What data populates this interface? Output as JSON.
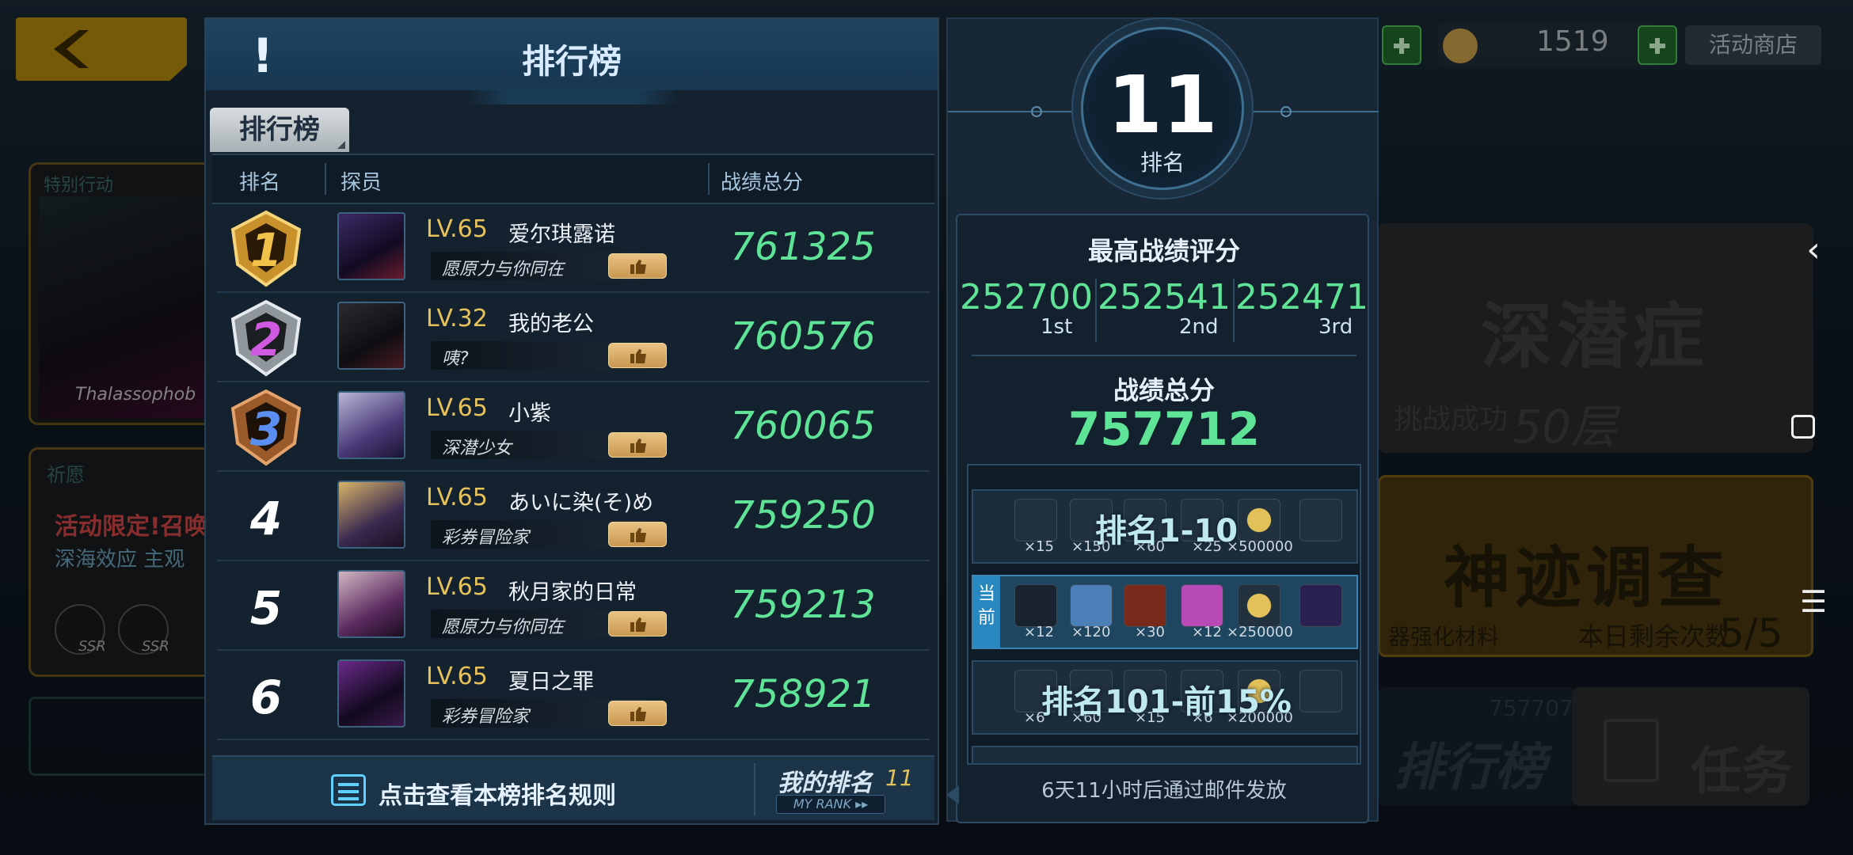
{
  "background": {
    "card1": {
      "tag": "特别行动",
      "name": "Thalassophob"
    },
    "card2": {
      "tag": "祈愿",
      "line1": "活动限定!召唤",
      "line2": "深海效应  主观",
      "ssr_label": "SSR"
    },
    "resource": {
      "value": "1519",
      "shop_label": "活动商店"
    },
    "event1": {
      "title": "深潜症",
      "status": "挑战成功",
      "floor": "50层"
    },
    "event2": {
      "title": "神迹调查",
      "sub": "器强化材料",
      "remain_label": "本日剩余次数",
      "remain": "5/5"
    },
    "btn_rank": {
      "label": "排行榜",
      "score": "757707"
    },
    "btn_task": {
      "label": "任务"
    }
  },
  "leaderboard": {
    "title": "排行榜",
    "tab": "排行榜",
    "columns": {
      "rank": "排名",
      "agent": "探员",
      "score": "战绩总分"
    },
    "rows": [
      {
        "rank": "1",
        "level": "LV.65",
        "name": "爱尔琪露诺",
        "title": "愿原力与你同在",
        "score": "761325"
      },
      {
        "rank": "2",
        "level": "LV.32",
        "name": "我的老公",
        "title": "咦?",
        "score": "760576"
      },
      {
        "rank": "3",
        "level": "LV.65",
        "name": "小紫",
        "title": "深潜少女",
        "score": "760065"
      },
      {
        "rank": "4",
        "level": "LV.65",
        "name": "あいに染(そ)め",
        "title": "彩券冒险家",
        "score": "759250"
      },
      {
        "rank": "5",
        "level": "LV.65",
        "name": "秋月家的日常",
        "title": "愿原力与你同在",
        "score": "759213"
      },
      {
        "rank": "6",
        "level": "LV.65",
        "name": "夏日之罪",
        "title": "彩券冒险家",
        "score": "758921"
      }
    ],
    "footer": {
      "rules_label": "点击查看本榜排名规则",
      "my_rank_label": "我的排名",
      "my_rank_value": "11",
      "my_rank_en": "MY RANK"
    }
  },
  "summary": {
    "rank": "11",
    "rank_label": "排名",
    "best_label": "最高战绩评分",
    "best": [
      {
        "value": "252700",
        "label": "1st"
      },
      {
        "value": "252541",
        "label": "2nd"
      },
      {
        "value": "252471",
        "label": "3rd"
      }
    ],
    "total_label": "战绩总分",
    "total": "757712",
    "tiers": [
      {
        "name": "排名1-10",
        "qty": [
          "×15",
          "×150",
          "×60",
          "×25",
          "×500000"
        ]
      },
      {
        "current_label": "当前",
        "qty": [
          "×12",
          "×120",
          "×30",
          "×12",
          "×250000"
        ]
      },
      {
        "name": "排名101-前15%",
        "qty": [
          "×6",
          "×60",
          "×15",
          "×6",
          "×200000"
        ]
      }
    ],
    "mail_note": "6天11小时后通过邮件发放"
  },
  "colors": {
    "score_green": "#5fe497",
    "level_gold": "#e7c25a",
    "panel": "#142230",
    "accent_blue": "#3a86b4"
  }
}
